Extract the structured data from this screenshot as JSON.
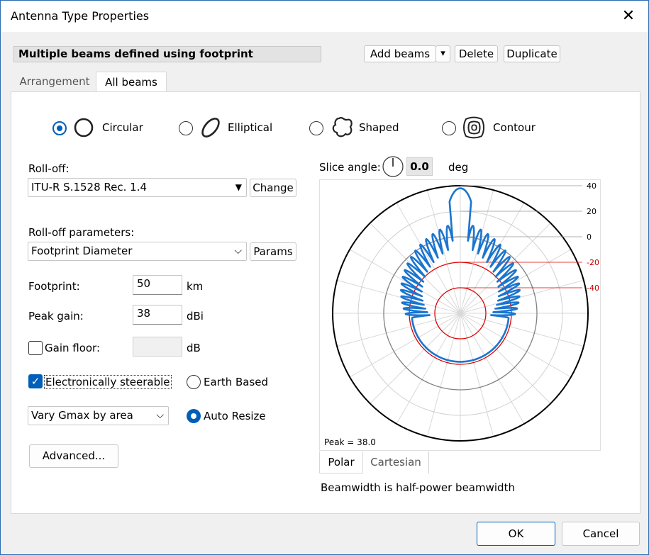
{
  "window": {
    "title": "Antenna Type Properties",
    "close": "✕"
  },
  "name_box": "Multiple beams defined using footprint",
  "toolbar": {
    "add_beams": "Add beams",
    "add_beams_dropdown": "▾",
    "delete": "Delete",
    "duplicate": "Duplicate"
  },
  "tabs": [
    {
      "label": "Arrangement",
      "selected": false
    },
    {
      "label": "All beams",
      "selected": true
    }
  ],
  "beam_shapes": [
    {
      "label": "Circular",
      "selected": true
    },
    {
      "label": "Elliptical",
      "selected": false
    },
    {
      "label": "Shaped",
      "selected": false
    },
    {
      "label": "Contour",
      "selected": false
    }
  ],
  "rolloff": {
    "label": "Roll-off:",
    "value": "ITU-R S.1528 Rec. 1.4",
    "change": "Change"
  },
  "rolloff_params": {
    "label": "Roll-off parameters:",
    "value": "Footprint Diameter",
    "params": "Params"
  },
  "footprint": {
    "label": "Footprint:",
    "value": "50",
    "unit": "km"
  },
  "peak_gain": {
    "label": "Peak gain:",
    "value": "38",
    "unit": "dBi"
  },
  "gain_floor": {
    "label": "Gain floor:",
    "value": "",
    "unit": "dB",
    "checked": false
  },
  "steerable": {
    "label": "Electronically steerable",
    "checked": true
  },
  "earth_based": {
    "label": "Earth Based",
    "selected": false
  },
  "vary": {
    "value": "Vary Gmax by area"
  },
  "auto_resize": {
    "label": "Auto Resize",
    "selected": true
  },
  "advanced": "Advanced...",
  "slice": {
    "label": "Slice angle:",
    "value": "0.0",
    "unit": "deg"
  },
  "plot_tabs": [
    {
      "label": "Polar",
      "selected": true
    },
    {
      "label": "Cartesian",
      "selected": false
    }
  ],
  "beamwidth_note": "Beamwidth is half-power beamwidth",
  "ok": "OK",
  "cancel": "Cancel",
  "colors": {
    "accent": "#005fb8",
    "pattern": "#1a75cf",
    "negative_ring": "#e00000",
    "ring": "#808080"
  },
  "chart_data": {
    "type": "polar",
    "radial_ticks": [
      "40",
      "20",
      "0",
      "-20",
      "-40"
    ],
    "radial_tick_values": [
      40,
      20,
      0,
      -20,
      -40
    ],
    "rlim": [
      -60,
      40
    ],
    "peak_label": "Peak = 38.0",
    "peak": 38.0,
    "grid": true,
    "angle_step_deg": 15
  }
}
